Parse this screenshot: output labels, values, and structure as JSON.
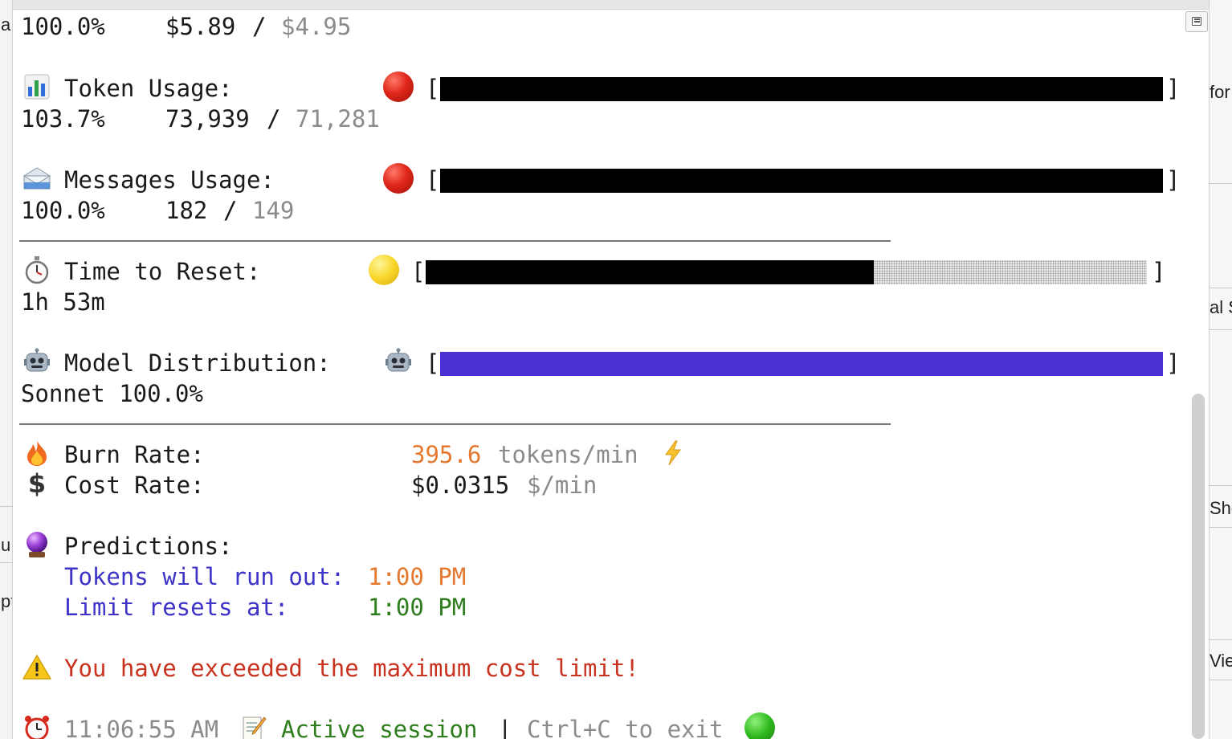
{
  "colors": {
    "bar_fill": "#000000",
    "model_fill": "#4b30d2",
    "warning_red": "#c8321e",
    "burn_orange": "#e3782e",
    "prediction_blue": "#3d33c8",
    "session_green": "#2e7d1c"
  },
  "background": {
    "left_fragments": [
      "a",
      "u",
      "pt"
    ],
    "right_fragments": [
      "for",
      "al S",
      "Sho",
      "View"
    ]
  },
  "cost": {
    "percent": "100.0%",
    "used": "$5.89",
    "separator": "/",
    "limit": "$4.95"
  },
  "tokens": {
    "icon": "bar-chart-icon",
    "label": "Token Usage:",
    "status": "red",
    "percent": "103.7%",
    "used": "73,939",
    "separator": "/",
    "limit": "71,281",
    "fill_fraction": 1.0
  },
  "messages": {
    "icon": "envelope-icon",
    "label": "Messages Usage:",
    "status": "red",
    "percent": "100.0%",
    "used": "182",
    "separator": "/",
    "limit": "149",
    "fill_fraction": 1.0
  },
  "reset": {
    "icon": "stopwatch-icon",
    "label": "Time to Reset:",
    "status": "yellow",
    "value": "1h 53m",
    "fill_fraction": 0.62
  },
  "model": {
    "icon": "robot-icon",
    "label": "Model Distribution:",
    "value": "Sonnet 100.0%",
    "fill_fraction": 1.0
  },
  "burn": {
    "icon": "fire-icon",
    "label": "Burn Rate:",
    "value": "395.6",
    "unit": "tokens/min",
    "trend_icon": "lightning-icon"
  },
  "cost_rate": {
    "icon": "dollar-icon",
    "label": "Cost Rate:",
    "value": "$0.0315",
    "unit": "$/min"
  },
  "predictions": {
    "icon": "crystal-ball-icon",
    "label": "Predictions:",
    "run_out_label": "Tokens will run out:",
    "run_out_time": "1:00 PM",
    "reset_label": "Limit resets at:",
    "reset_time": "1:00 PM"
  },
  "warning": {
    "icon": "warning-icon",
    "text": "You have exceeded the maximum cost limit!"
  },
  "footer": {
    "clock_icon": "alarm-clock-icon",
    "time": "11:06:55 AM",
    "memo_icon": "memo-icon",
    "session": "Active session",
    "separator": "|",
    "hint": "Ctrl+C to exit",
    "status_icon": "green-circle-icon"
  }
}
